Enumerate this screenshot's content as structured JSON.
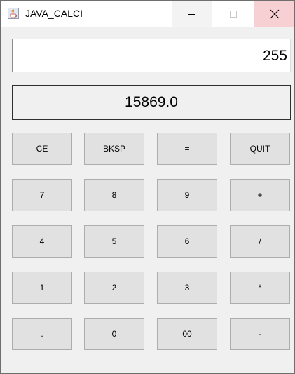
{
  "window": {
    "title": "JAVA_CALCI",
    "controls": {
      "minimize": "minimize-icon",
      "maximize": "maximize-icon",
      "close": "close-icon"
    }
  },
  "display": {
    "input_value": "255",
    "result_value": "15869.0"
  },
  "keypad": {
    "rows": [
      [
        "CE",
        "BKSP",
        "=",
        "QUIT"
      ],
      [
        "7",
        "8",
        "9",
        "+"
      ],
      [
        "4",
        "5",
        "6",
        "/"
      ],
      [
        "1",
        "2",
        "3",
        "*"
      ],
      [
        ".",
        "0",
        "00",
        "-"
      ]
    ]
  },
  "colors": {
    "close_hover_bg": "#f7d0d3",
    "key_bg": "#e1e1e1",
    "window_bg": "#f0f0f0"
  }
}
